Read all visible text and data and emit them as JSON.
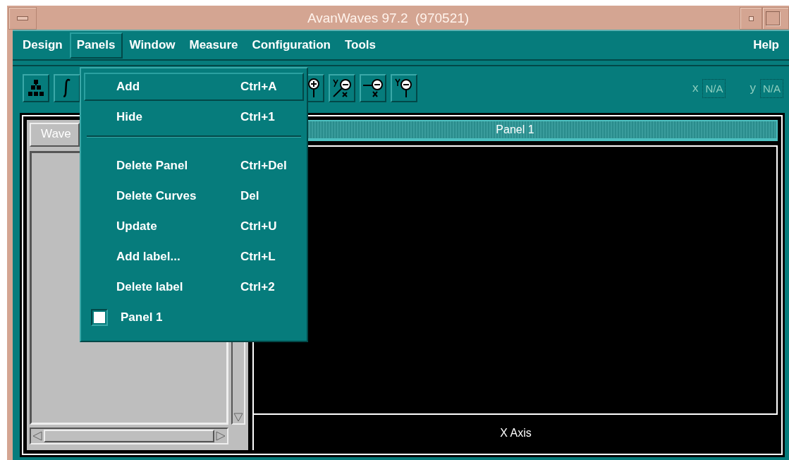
{
  "window": {
    "title": "AvanWaves 97.2  (970521)"
  },
  "menubar": [
    {
      "label": "Design",
      "selected": false
    },
    {
      "label": "Panels",
      "selected": true
    },
    {
      "label": "Window",
      "selected": false
    },
    {
      "label": "Measure",
      "selected": false
    },
    {
      "label": "Configuration",
      "selected": false
    },
    {
      "label": "Tools",
      "selected": false
    }
  ],
  "help_menu": {
    "label": "Help"
  },
  "toolbar": {
    "x_label": "x",
    "x_value": "N/A",
    "y_label": "y",
    "y_value": "N/A"
  },
  "waveform_list": {
    "tab": "Wave"
  },
  "plot_panel": {
    "title": "Panel 1",
    "x_axis": "X Axis"
  },
  "panels_menu": [
    {
      "kind": "command",
      "label": "Add",
      "shortcut": "Ctrl+A",
      "selected": true
    },
    {
      "kind": "command",
      "label": "Hide",
      "shortcut": "Ctrl+1",
      "selected": false
    },
    {
      "kind": "separator"
    },
    {
      "kind": "command",
      "label": "Delete Panel",
      "shortcut": "Ctrl+Del",
      "selected": false
    },
    {
      "kind": "command",
      "label": "Delete Curves",
      "shortcut": "Del",
      "selected": false
    },
    {
      "kind": "command",
      "label": "Update",
      "shortcut": "Ctrl+U",
      "selected": false
    },
    {
      "kind": "command",
      "label": "Add label...",
      "shortcut": "Ctrl+L",
      "selected": false
    },
    {
      "kind": "command",
      "label": "Delete label",
      "shortcut": "Ctrl+2",
      "selected": false
    },
    {
      "kind": "toggle",
      "label": "Panel 1",
      "checked": false,
      "selected": false
    }
  ]
}
